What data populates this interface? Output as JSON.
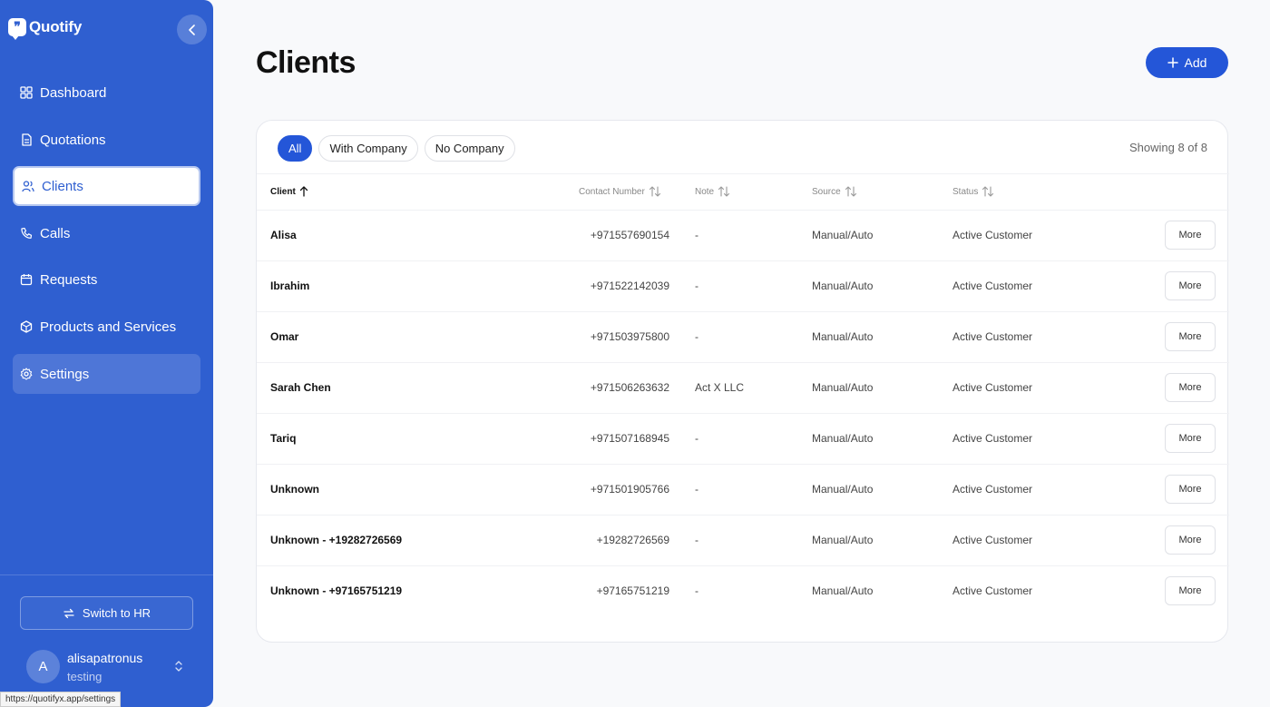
{
  "app": {
    "name": "Quotify"
  },
  "sidebar": {
    "items": [
      {
        "label": "Dashboard",
        "icon": "dashboard-grid-icon"
      },
      {
        "label": "Quotations",
        "icon": "document-icon"
      },
      {
        "label": "Clients",
        "icon": "users-icon",
        "active": true
      },
      {
        "label": "Calls",
        "icon": "phone-icon"
      },
      {
        "label": "Requests",
        "icon": "calendar-icon"
      },
      {
        "label": "Products and Services",
        "icon": "box-icon"
      },
      {
        "label": "Settings",
        "icon": "gear-icon",
        "hover": true
      }
    ],
    "switch_label": "Switch to HR",
    "user": {
      "initial": "A",
      "name": "alisapatronus",
      "subtitle": "testing"
    }
  },
  "status_url": "https://quotifyx.app/settings",
  "page": {
    "title": "Clients",
    "add_label": "Add"
  },
  "filters": [
    {
      "label": "All",
      "active": true
    },
    {
      "label": "With Company",
      "active": false
    },
    {
      "label": "No Company",
      "active": false
    }
  ],
  "showing": "Showing 8 of 8",
  "table": {
    "columns": [
      "Client",
      "Contact Number",
      "Note",
      "Source",
      "Status"
    ],
    "more_label": "More",
    "rows": [
      {
        "client": "Alisa",
        "phone": "+971557690154",
        "note": "-",
        "source": "Manual/Auto",
        "status": "Active Customer"
      },
      {
        "client": "Ibrahim",
        "phone": "+971522142039",
        "note": "-",
        "source": "Manual/Auto",
        "status": "Active Customer"
      },
      {
        "client": "Omar",
        "phone": "+971503975800",
        "note": "-",
        "source": "Manual/Auto",
        "status": "Active Customer"
      },
      {
        "client": "Sarah Chen",
        "phone": "+971506263632",
        "note": "Act X LLC",
        "source": "Manual/Auto",
        "status": "Active Customer"
      },
      {
        "client": "Tariq",
        "phone": "+971507168945",
        "note": "-",
        "source": "Manual/Auto",
        "status": "Active Customer"
      },
      {
        "client": "Unknown",
        "phone": "+971501905766",
        "note": "-",
        "source": "Manual/Auto",
        "status": "Active Customer"
      },
      {
        "client": "Unknown - +19282726569",
        "phone": "+19282726569",
        "note": "-",
        "source": "Manual/Auto",
        "status": "Active Customer"
      },
      {
        "client": "Unknown - +97165751219",
        "phone": "+97165751219",
        "note": "-",
        "source": "Manual/Auto",
        "status": "Active Customer"
      }
    ]
  },
  "colors": {
    "sidebar": "#2f5fd0",
    "accent": "#2456d8",
    "background": "#f8f9fb"
  }
}
